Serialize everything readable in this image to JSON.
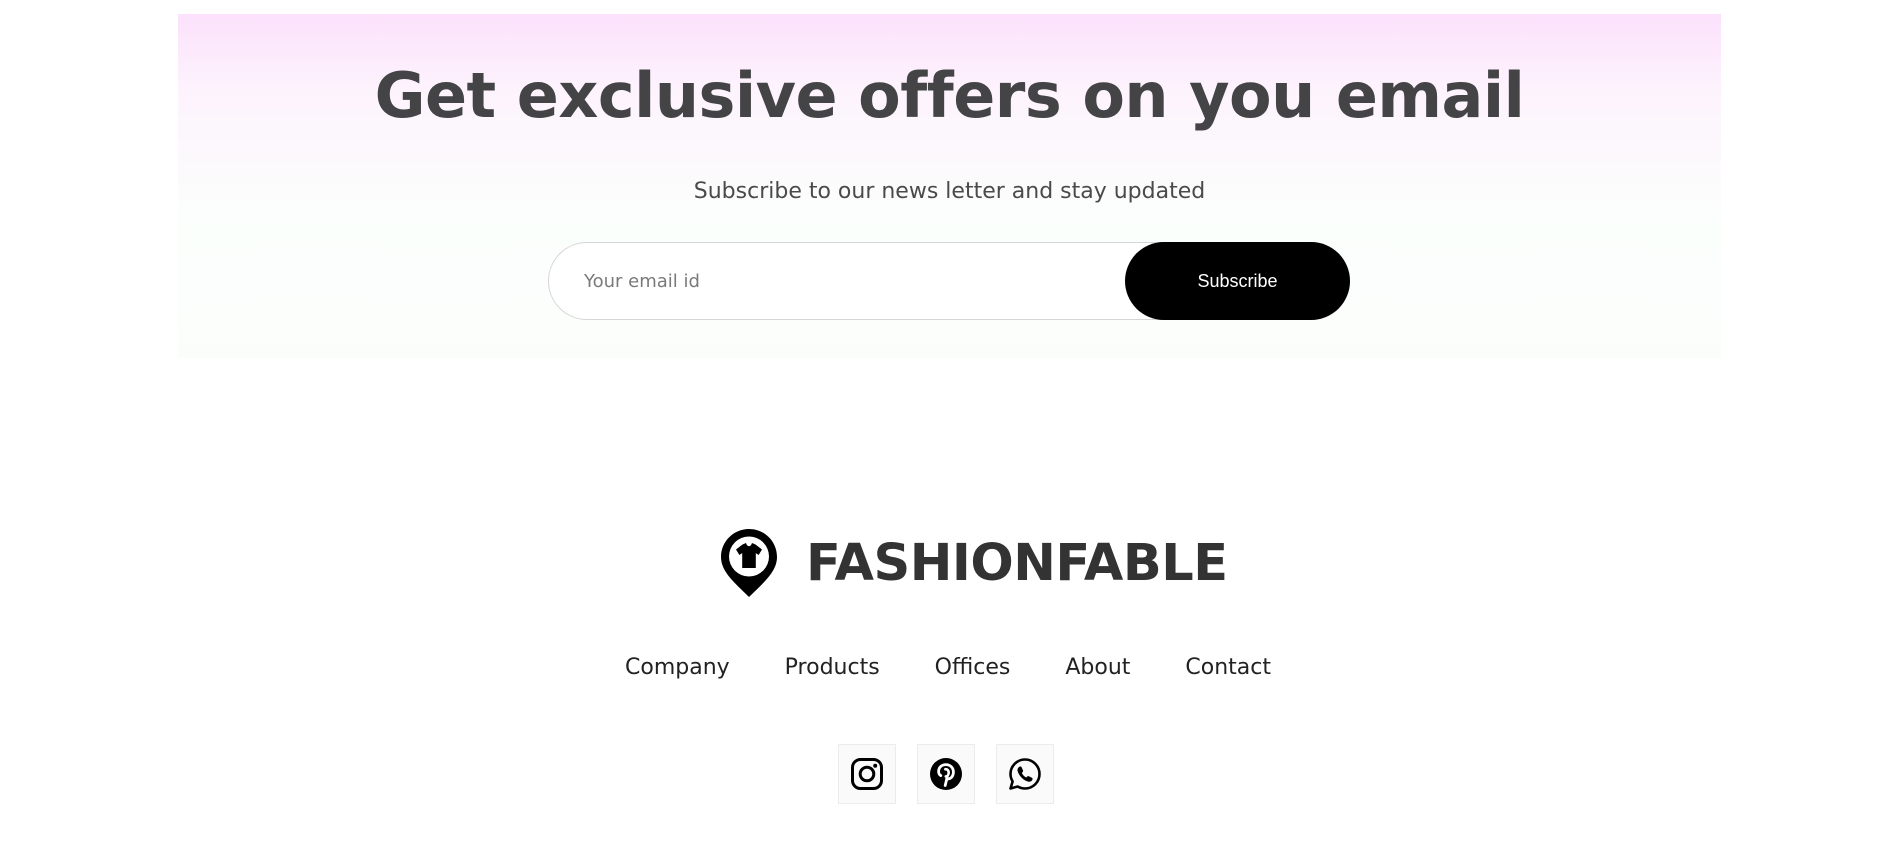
{
  "newsletter": {
    "title": "Get exclusive offers on you email",
    "subtitle": "Subscribe to our news letter and stay updated",
    "email_placeholder": "Your email id",
    "email_value": "",
    "subscribe_label": "Subscribe"
  },
  "brand": {
    "name": "FASHIONFABLE",
    "logo_icon": "map-pin-tshirt-icon"
  },
  "footer_nav": {
    "items": [
      {
        "label": "Company"
      },
      {
        "label": "Products"
      },
      {
        "label": "Offices"
      },
      {
        "label": "About"
      },
      {
        "label": "Contact"
      }
    ]
  },
  "socials": [
    {
      "icon": "instagram-icon"
    },
    {
      "icon": "pinterest-icon"
    },
    {
      "icon": "whatsapp-icon"
    }
  ],
  "colors": {
    "newsletter_gradient_top": "#fce1fc",
    "newsletter_gradient_bottom": "#fbfdfb",
    "button_bg": "#000000",
    "button_text": "#ffffff",
    "heading_text": "#444345"
  }
}
